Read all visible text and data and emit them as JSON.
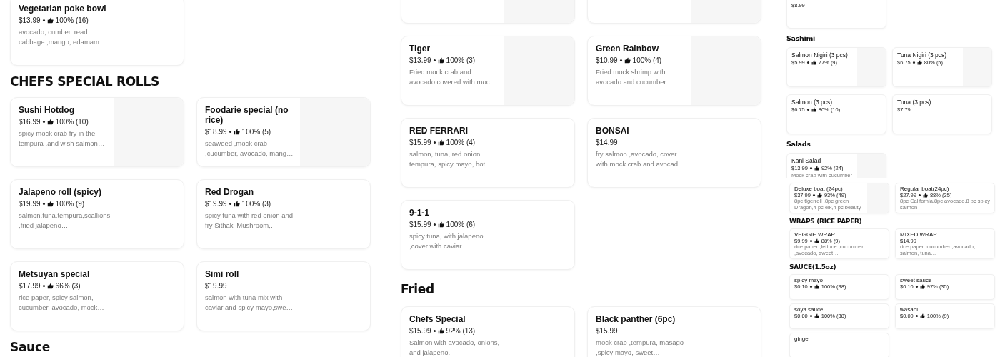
{
  "panels": [
    {
      "sections": [
        {
          "items": [
            {
              "name": "Vegetarian poke bowl",
              "price": "$13.99",
              "rating": "100% (16)",
              "description": "avocado, cumber, read cabbage ,mango, edamam…",
              "has_image": false
            }
          ]
        },
        {
          "heading": "CHEFS SPECIAL ROLLS",
          "items": [
            {
              "name": "Sushi Hotdog",
              "price": "$16.99",
              "rating": "100% (10)",
              "description": "spicy mock crab fry in the tempura ,and wish salmon…",
              "has_image": true
            },
            {
              "name": "Foodarie  special (no rice)",
              "price": "$18.99",
              "rating": "100% (5)",
              "description": "seaweed ,mock crab ,cucumber, avocado, mang…",
              "has_image": true
            },
            {
              "name": "Jalapeno roll (spicy)",
              "price": "$19.99",
              "rating": "100% (9)",
              "description": "salmon,tuna.tempura,scallions,fried jalapeno…",
              "has_image": false
            },
            {
              "name": "Red Drogan",
              "price": "$19.99",
              "rating": "100% (3)",
              "description": "spicy tuna with red onion and fry Sithaki Mushroom,…",
              "has_image": false
            },
            {
              "name": "Metsuyan special",
              "price": "$17.99",
              "rating": "66% (3)",
              "description": "rice paper, spicy salmon, cucumber, avocado, mock…",
              "has_image": false
            },
            {
              "name": "Simi roll",
              "price": "$19.99",
              "description": "salmon with tuna mix with caviar and spicy mayo,swe…",
              "has_image": false
            }
          ]
        },
        {
          "heading": "Sauce"
        }
      ]
    },
    {
      "sections": [
        {
          "items": [
            {
              "has_image": true
            },
            {
              "has_image": true
            },
            {
              "name": "Tiger",
              "price": "$13.99",
              "rating": "100% (3)",
              "description": "Fried mock crab and avocado covered with moc…",
              "has_image": true
            },
            {
              "name": "Green Rainbow",
              "price": "$10.99",
              "rating": "100% (4)",
              "description": "Fried mock shrimp with avocado and cucumber…",
              "has_image": true
            },
            {
              "name": "RED FERRARI",
              "price": "$15.99",
              "rating": "100% (4)",
              "description": "salmon, tuna, red onion tempura, spicy mayo, hot…",
              "has_image": false
            },
            {
              "name": "BONSAI",
              "price": "$14.99",
              "description": "fry salmon ,avocado, cover with mock crab and avocad…",
              "has_image": false
            },
            {
              "name": "9-1-1",
              "price": "$15.99",
              "rating": "100% (6)",
              "description": "spicy tuna, with jalapeno ,cover with caviar",
              "has_image": false
            }
          ]
        },
        {
          "heading": "Fried",
          "items": [
            {
              "name": "Chefs Special",
              "price": "$15.99",
              "rating": "92% (13)",
              "description": "Salmon with avocado, onions, and jalapeno.",
              "has_image": false
            },
            {
              "name": "Black panther (6pc)",
              "price": "$15.99",
              "description": "mock crab ,tempura, masago ,spicy mayo, sweet…",
              "has_image": false
            }
          ]
        }
      ]
    },
    {
      "sections": [
        {
          "items": [
            {
              "price": "$8.99",
              "has_image": false
            }
          ]
        },
        {
          "heading": "Sashimi",
          "items": [
            {
              "name": "Salmon Nigiri (3 pcs)",
              "price": "$5.99",
              "rating": "77% (9)",
              "has_image": true
            },
            {
              "name": "Tuna Nigiri (3 pcs)",
              "price": "$6.75",
              "rating": "80% (5)",
              "has_image": true
            },
            {
              "name": "Salmon (3 pcs)",
              "price": "$6.75",
              "rating": "80% (10)",
              "has_image": false
            },
            {
              "name": "Tuna (3 pcs)",
              "price": "$7.79",
              "has_image": false
            }
          ]
        },
        {
          "heading": "Salads",
          "items": [
            {
              "name": "Kani Salad",
              "price": "$13.99",
              "rating": "92% (24)",
              "description": "Mock crab with cucumber",
              "has_image": true
            }
          ]
        }
      ]
    },
    {
      "sections": [
        {
          "items": [
            {
              "name": "Deluxe boat (24pc)",
              "price": "$37.99",
              "rating": "93% (49)",
              "description": "8pc tigerroll ,8pc green Dragon,4 pc elk,4 pc beauty",
              "has_image": true
            },
            {
              "name": "Regular boat(24pc)",
              "price": "$27.99",
              "rating": "88% (35)",
              "description": "8pc California,8pc avocado,8 pc spicy salmon",
              "has_image": false
            }
          ]
        },
        {
          "heading": "WRAPS (RICE PAPER)",
          "items": [
            {
              "name": "VEGGIE WRAP",
              "price": "$9.99",
              "rating": "88% (9)",
              "description": "rice paper ,lettuce ,cucumber ,avocado, sweet…",
              "has_image": false
            },
            {
              "name": "MIXED WRAP",
              "price": "$14.99",
              "description": "rice paper ,cucumber ,avocado, salmon, tuna…",
              "has_image": false
            }
          ]
        },
        {
          "heading": "SAUCE(1.5oz)",
          "items": [
            {
              "name": "spicy  mayo",
              "price": "$0.10",
              "rating": "100% (38)",
              "has_image": false
            },
            {
              "name": "sweet sauce",
              "price": "$0.10",
              "rating": "97% (35)",
              "has_image": false
            },
            {
              "name": "soya sauce",
              "price": "$0.00",
              "rating": "100% (38)",
              "has_image": false
            },
            {
              "name": "wasabi",
              "price": "$0.00",
              "rating": "100% (9)",
              "has_image": false
            },
            {
              "name": "ginger",
              "has_image": false
            }
          ]
        }
      ]
    }
  ]
}
